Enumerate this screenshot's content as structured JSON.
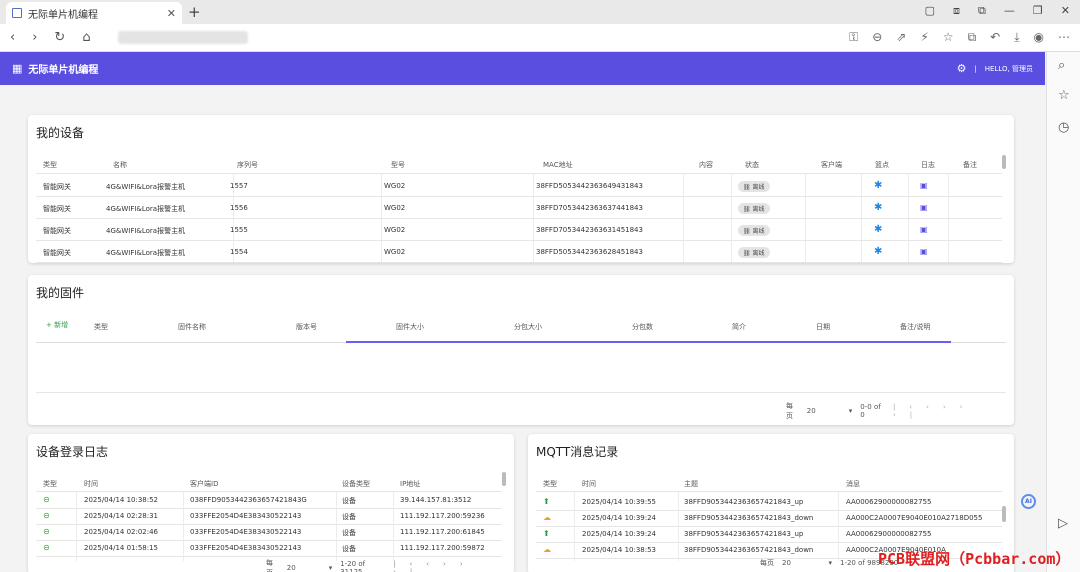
{
  "browser": {
    "tab_title": "无际单片机编程",
    "tab_close": "✕",
    "new_tab": "+",
    "nav": [
      "‹",
      "›",
      "↻",
      "⌂"
    ],
    "right_icons": [
      "⚿",
      "⊖",
      "⇗",
      "⚡",
      "☆",
      "⧉",
      "↶",
      "⤓",
      "◉",
      "⋯"
    ],
    "window_buttons": [
      "▢",
      "⧈",
      "⧉",
      "—",
      "❐",
      "✕"
    ],
    "side_icons": [
      "⌕",
      "☆",
      "◷",
      "▷"
    ]
  },
  "header": {
    "title": "无际单片机编程",
    "greeting": "HELLO, 管理员",
    "divider": "|",
    "settings_icon": "⚙",
    "logo_icon": "▦"
  },
  "devices": {
    "title": "我的设备",
    "columns": [
      "类型",
      "名称",
      "序列号",
      "型号",
      "MAC地址",
      "内容",
      "状态",
      "客户端",
      "篮点",
      "日志",
      "备注"
    ],
    "rows": [
      {
        "type": "智能网关",
        "name": "4G&WIFI&Lora报警主机",
        "serial": "1557",
        "model": "WG02",
        "mac": "38FFD5053442363649431843",
        "status": "离线"
      },
      {
        "type": "智能网关",
        "name": "4G&WIFI&Lora报警主机",
        "serial": "1556",
        "model": "WG02",
        "mac": "38FFD7053442363637441843",
        "status": "离线"
      },
      {
        "type": "智能网关",
        "name": "4G&WIFI&Lora报警主机",
        "serial": "1555",
        "model": "WG02",
        "mac": "38FFD7053442363631451843",
        "status": "离线"
      },
      {
        "type": "智能网关",
        "name": "4G&WIFI&Lora报警主机",
        "serial": "1554",
        "model": "WG02",
        "mac": "38FFD5053442363628451843",
        "status": "离线"
      }
    ]
  },
  "firmware": {
    "title": "我的固件",
    "add_label": "+ 新增",
    "columns": [
      "类型",
      "固件名称",
      "版本号",
      "固件大小",
      "分包大小",
      "分包数",
      "简介",
      "日期",
      "备注/说明"
    ],
    "pager": {
      "per_page_label": "每页",
      "per_page": "20",
      "range": "0-0 of 0"
    }
  },
  "login_log": {
    "title": "设备登录日志",
    "columns": [
      "类型",
      "时间",
      "客户端ID",
      "设备类型",
      "IP地址"
    ],
    "rows": [
      {
        "time": "2025/04/14 10:38:52",
        "client": "038FFD9053442363657421843G",
        "dtype": "设备",
        "ip": "39.144.157.81:3512"
      },
      {
        "time": "2025/04/14 02:28:31",
        "client": "033FFE2054D4E383430522143",
        "dtype": "设备",
        "ip": "111.192.117.200:59236"
      },
      {
        "time": "2025/04/14 02:02:46",
        "client": "033FFE2054D4E383430522143",
        "dtype": "设备",
        "ip": "111.192.117.200:61845"
      },
      {
        "time": "2025/04/14 01:58:15",
        "client": "033FFE2054D4E383430522143",
        "dtype": "设备",
        "ip": "111.192.117.200:59872"
      }
    ],
    "pager": {
      "per_page_label": "每页",
      "per_page": "20",
      "range": "1-20 of 31125"
    }
  },
  "mqtt": {
    "title": "MQTT消息记录",
    "columns": [
      "类型",
      "时间",
      "主题",
      "消息"
    ],
    "rows": [
      {
        "time": "2025/04/14 10:39:55",
        "topic": "38FFD9053442363657421843_up",
        "msg": "AA00062900000082755"
      },
      {
        "time": "2025/04/14 10:39:24",
        "topic": "38FFD9053442363657421843_down",
        "msg": "AA000C2A0007E9040E010A2718D055"
      },
      {
        "time": "2025/04/14 10:39:24",
        "topic": "38FFD9053442363657421843_up",
        "msg": "AA00062900000082755"
      },
      {
        "time": "2025/04/14 10:38:53",
        "topic": "38FFD9053442363657421843_down",
        "msg": "AA000C2A0007E9040E010A"
      }
    ],
    "pager": {
      "per_page_label": "每页",
      "per_page": "20",
      "range": "1-20 of 9898230"
    }
  },
  "watermark": "PCB联盟网（Pcbbar.com）",
  "ai_badge": "AI"
}
